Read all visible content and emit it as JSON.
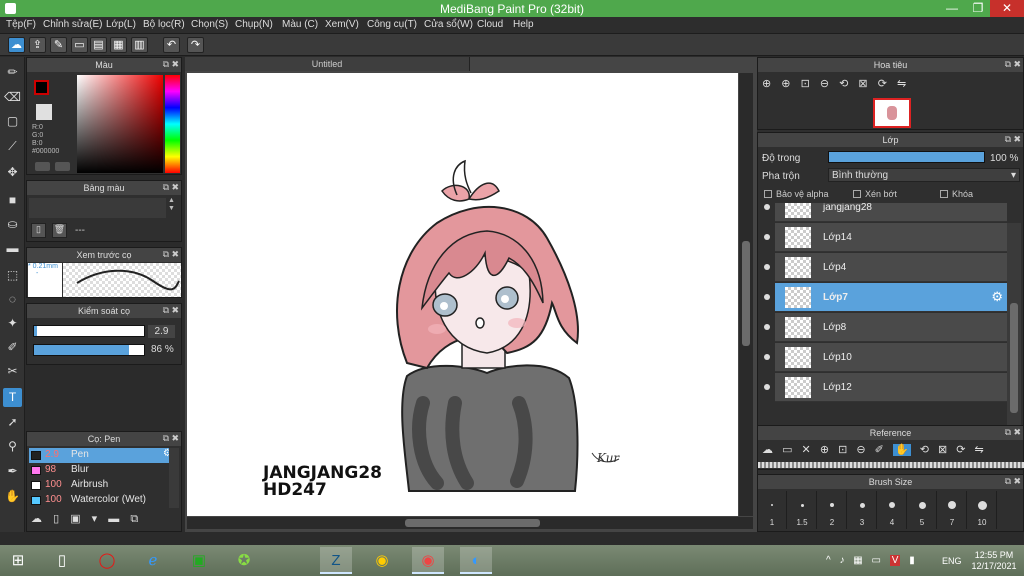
{
  "window": {
    "title": "MediBang Paint Pro (32bit)",
    "min": "—",
    "max": "❐",
    "close": "✕"
  },
  "menu": [
    "Tệp(F)",
    "Chỉnh sửa(E)",
    "Lớp(L)",
    "Bộ lọc(R)",
    "Chọn(S)",
    "Chụp(N)",
    "Màu (C)",
    "Xem(V)",
    "Công cụ(T)",
    "Cửa sổ(W)",
    "Cloud",
    "Help"
  ],
  "color_panel": {
    "title": "Màu",
    "r": "R:0",
    "g": "G:0",
    "b": "B:0",
    "hex": "#000000"
  },
  "palette_panel": {
    "title": "Bảng màu",
    "dash": "---"
  },
  "preview_panel": {
    "title": "Xem trước cọ",
    "size": "* 0.21mm",
    "dash": "-"
  },
  "brush_control": {
    "title": "Kiểm soát cọ",
    "size_value": "2.9",
    "opacity_value": "86 %",
    "size_level": 0.03,
    "opacity_level": 0.86
  },
  "brush_panel": {
    "title": "Cọ: Pen",
    "brushes": [
      {
        "size": "2.9",
        "name": "Pen",
        "color": "#222222",
        "selected": true
      },
      {
        "size": "98",
        "name": "Blur",
        "color": "#ff77ee",
        "selected": false
      },
      {
        "size": "100",
        "name": "Airbrush",
        "color": "#ffffff",
        "selected": false
      },
      {
        "size": "100",
        "name": "Watercolor (Wet)",
        "color": "#55c8ff",
        "selected": false
      }
    ]
  },
  "document": {
    "tab": "Untitled",
    "text_line1": "JANGJANG28",
    "text_line2": "HD247",
    "signature": "Kur"
  },
  "navigator": {
    "title": "Hoa tiêu"
  },
  "layers": {
    "title": "Lớp",
    "opacity_label": "Độ trong",
    "opacity_value": "100 %",
    "opacity_level": 1.0,
    "blend_label": "Pha trộn",
    "blend_value": "Bình thường",
    "protect_alpha": "Bảo vệ alpha",
    "clipping": "Xén bớt",
    "lock": "Khóa",
    "items": [
      {
        "name": "jangjang28",
        "selected": false
      },
      {
        "name": "Lớp14",
        "selected": false
      },
      {
        "name": "Lớp4",
        "selected": false
      },
      {
        "name": "Lớp7",
        "selected": true
      },
      {
        "name": "Lớp8",
        "selected": false
      },
      {
        "name": "Lớp10",
        "selected": false
      },
      {
        "name": "Lớp12",
        "selected": false
      }
    ]
  },
  "reference": {
    "title": "Reference"
  },
  "brush_size": {
    "title": "Brush Size",
    "sizes": [
      "1",
      "1.5",
      "2",
      "3",
      "4",
      "5",
      "7",
      "10"
    ]
  },
  "taskbar": {
    "time": "12:55 PM",
    "date": "12/17/2021",
    "lang": "ENG"
  },
  "colors": {
    "accent": "#3d8fd1",
    "titlebar": "#4fa84c",
    "selected_layer": "#5aa2dc"
  }
}
